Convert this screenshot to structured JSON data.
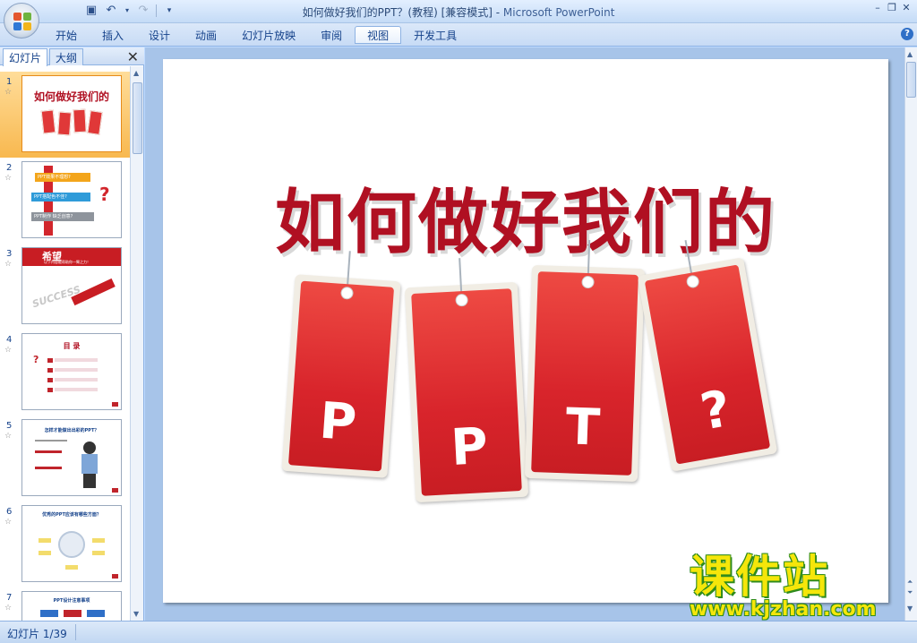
{
  "window": {
    "title": "如何做好我们的PPT？(教程) [兼容模式] - ",
    "app_name": "Microsoft PowerPoint"
  },
  "quick_access": {
    "save_icon": "save-icon",
    "undo_icon": "undo-icon",
    "redo_icon": "redo-icon",
    "customize_icon": "customize-icon"
  },
  "ribbon": {
    "tabs": [
      "开始",
      "插入",
      "设计",
      "动画",
      "幻灯片放映",
      "审阅",
      "视图",
      "开发工具"
    ],
    "active_tab": "视图"
  },
  "left_panel": {
    "tab_slides": "幻灯片",
    "tab_outline": "大纲",
    "close": "✕",
    "thumbnails": [
      {
        "number": "1",
        "star": "☆",
        "title": "如何做好我们的"
      },
      {
        "number": "2",
        "star": "☆",
        "lines": [
          "PPT效果不理想?",
          "PPT搭配色不佳?",
          "PPT制作 缺乏创意?"
        ]
      },
      {
        "number": "3",
        "star": "☆",
        "title": "希望",
        "subtitle": "以下内容能帮助你一臂之力！",
        "word": "SUCCESS"
      },
      {
        "number": "4",
        "star": "☆",
        "title": "目 录"
      },
      {
        "number": "5",
        "star": "☆",
        "title": "怎样才能做出出彩的PPT？"
      },
      {
        "number": "6",
        "star": "☆",
        "title": "优秀的PPT应该有哪些方面？"
      },
      {
        "number": "7",
        "star": "☆",
        "title": "PPT设计注意事项"
      }
    ]
  },
  "slide": {
    "title": "如何做好我们的",
    "tags": [
      "P",
      "P",
      "T",
      "?"
    ]
  },
  "watermark": {
    "text": "课件站",
    "url": "www.kjzhan.com"
  },
  "status": {
    "slide_indicator": "幻灯片 1/39"
  }
}
